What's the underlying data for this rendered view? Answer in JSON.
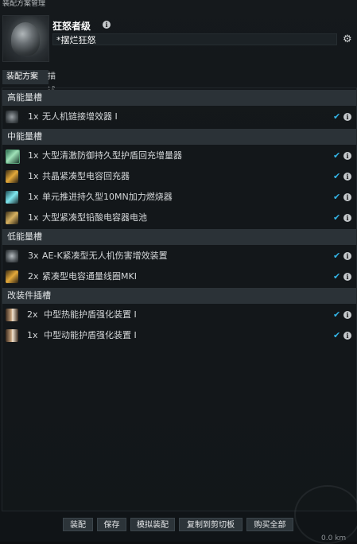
{
  "window": {
    "title": "装配方案管理"
  },
  "header": {
    "ship_name": "狂怒者级",
    "fit_name": "*摆烂狂怒",
    "portrait_icon": "ship-portrait",
    "settings_icon": "gear-icon"
  },
  "tabs": [
    {
      "label": "装配方案",
      "active": true
    },
    {
      "label": "描述",
      "active": false
    }
  ],
  "groups": [
    {
      "header": "高能量槽",
      "rows": [
        {
          "qty": "1x",
          "label": "无人机链接增效器 I",
          "icon": "drone-link-icon"
        }
      ]
    },
    {
      "header": "中能量槽",
      "rows": [
        {
          "qty": "1x",
          "label": "大型清激防御持久型护盾回充增量器",
          "icon": "shield-booster-icon"
        },
        {
          "qty": "1x",
          "label": "共晶紧凑型电容回充器",
          "icon": "cap-recharger-icon"
        },
        {
          "qty": "1x",
          "label": "单元推进持久型10MN加力燃烧器",
          "icon": "afterburner-icon"
        },
        {
          "qty": "1x",
          "label": "大型紧凑型铅酸电容器电池",
          "icon": "cap-battery-icon"
        }
      ]
    },
    {
      "header": "低能量槽",
      "rows": [
        {
          "qty": "3x",
          "label": "AE-K紧凑型无人机伤害增效装置",
          "icon": "drone-damage-icon"
        },
        {
          "qty": "2x",
          "label": "紧凑型电容通量线圈MKI",
          "icon": "flux-coil-icon"
        }
      ]
    },
    {
      "header": "改装件插槽",
      "rows": [
        {
          "qty": "2x",
          "label": "中型热能护盾强化装置 I",
          "icon": "rig-thermal-icon"
        },
        {
          "qty": "1x",
          "label": "中型动能护盾强化装置 I",
          "icon": "rig-kinetic-icon"
        }
      ]
    }
  ],
  "buttons": {
    "fit": "装配",
    "save": "保存",
    "simulate": "模拟装配",
    "copy": "复制到剪切板",
    "buy_all": "购买全部"
  },
  "colors": {
    "check": "#33b4e6",
    "group_header_bg": "#2b3237",
    "window_bg": "#121619"
  },
  "corner_readout": "0.0 km"
}
